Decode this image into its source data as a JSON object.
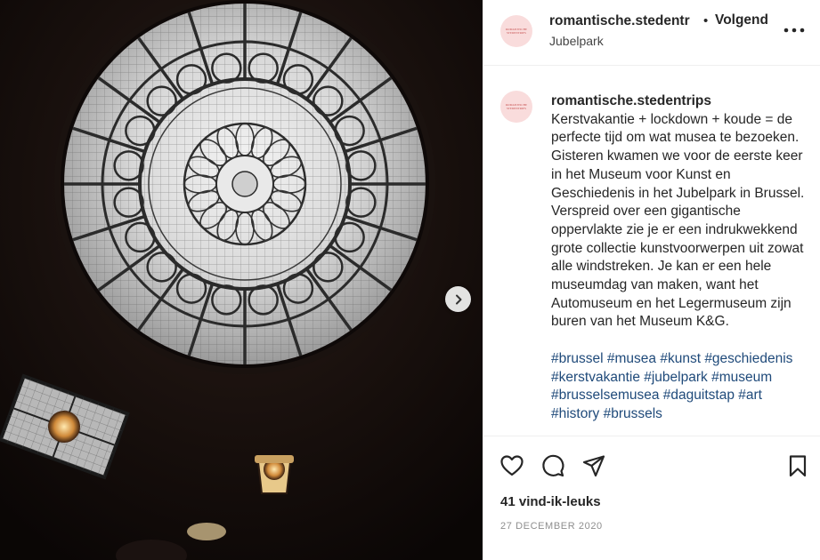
{
  "post": {
    "username": "romantische.stedentr",
    "dot": "•",
    "follow_label": "Volgend",
    "location": "Jubelpark",
    "avatar_text": "ROMANTISCHE STEDENTRIPS"
  },
  "caption": {
    "username": "romantische.stedentrips",
    "text": "Kerstvakantie + lockdown + koude = de perfecte tijd om wat musea te bezoeken. Gisteren kwamen we voor de eerste keer in het Museum voor Kunst en Geschiedenis in het Jubelpark in Brussel. Verspreid over een gigantische oppervlakte zie je er een indrukwekkend grote collectie kunstvoorwerpen uit zowat alle windstreken. Je kan er een hele museumdag van maken, want het Automuseum en het Legermuseum zijn buren van het Museum K&G.",
    "hashtags": "#brussel #musea #kunst #geschiedenis #kerstvakantie #jubelpark #museum #brusselsemusea #daguitstap #art #history #brussels"
  },
  "engagement": {
    "likes": "41 vind-ik-leuks",
    "date": "27 DECEMBER 2020"
  },
  "icons": {
    "like": "heart-icon",
    "comment": "comment-icon",
    "share": "share-icon",
    "save": "bookmark-icon",
    "more": "more-icon",
    "next": "chevron-right-icon"
  },
  "colors": {
    "hashtag": "#1f4a7a",
    "avatar_bg": "#f9dcdc",
    "divider": "#efefef",
    "date": "#8e8e8e"
  }
}
